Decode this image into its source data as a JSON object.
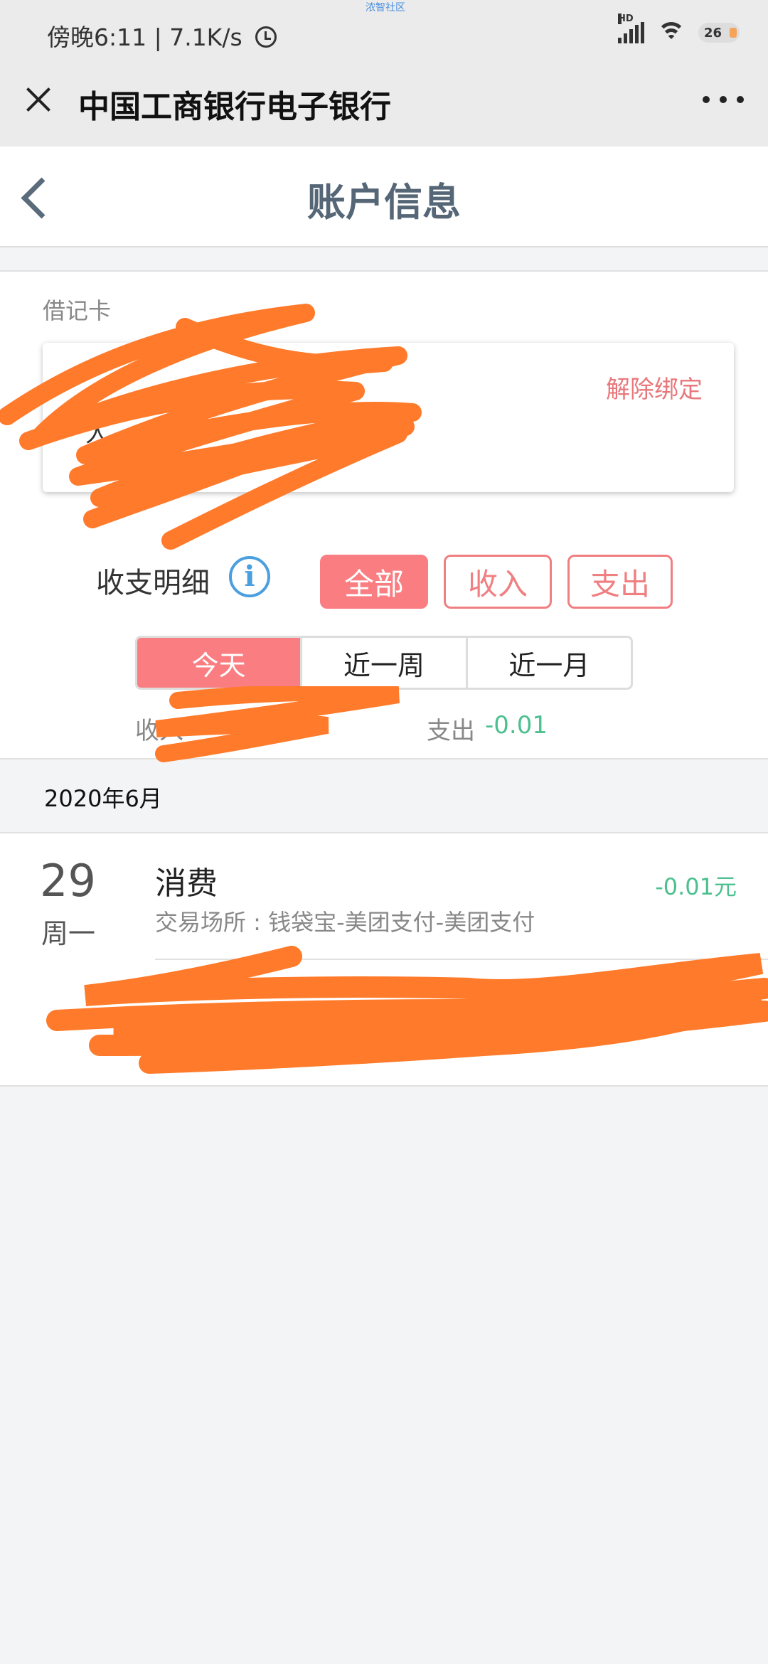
{
  "status_bar": {
    "left_text": "傍晚6:11 | 7.1K/s",
    "watermark": "浓智社区",
    "battery": "26"
  },
  "title_bar": {
    "title": "中国工商银行电子银行"
  },
  "header": {
    "title": "账户信息"
  },
  "card": {
    "type_label": "借记卡",
    "holder_partial": "人",
    "unbind_label": "解除绑定"
  },
  "details": {
    "label": "收支明细",
    "filters": [
      "全部",
      "收入",
      "支出"
    ],
    "active_filter": "全部",
    "periods": [
      "今天",
      "近一周",
      "近一月"
    ],
    "active_period": "今天",
    "income_label": "收入",
    "expense_label": "支出",
    "expense_value": "-0.01"
  },
  "month": {
    "label": "2020年6月"
  },
  "transactions": [
    {
      "day": "29",
      "weekday": "周一",
      "type": "消费",
      "amount": "-0.01元",
      "place": "交易场所 : 钱袋宝-美团支付-美团支付"
    }
  ],
  "colors": {
    "accent": "#fa7d82",
    "positive_green": "#4cc08f",
    "info_blue": "#4a9fdf",
    "redaction": "#ff7a2a"
  }
}
